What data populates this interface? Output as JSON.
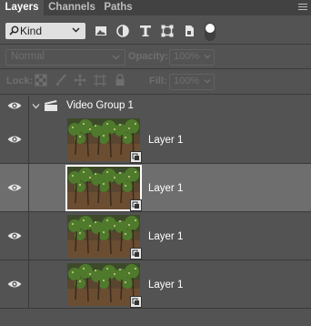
{
  "tabs": [
    {
      "label": "Layers",
      "active": true
    },
    {
      "label": "Channels",
      "active": false
    },
    {
      "label": "Paths",
      "active": false
    }
  ],
  "filter": {
    "kind_label": "Kind",
    "icons": [
      "image-filter-icon",
      "adjustment-filter-icon",
      "type-filter-icon",
      "shape-filter-icon",
      "smart-object-filter-icon",
      "filter-toggle-icon"
    ]
  },
  "blend": {
    "mode": "Normal",
    "opacity_label": "Opacity:",
    "opacity_value": "100%",
    "fill_label": "Fill:",
    "fill_value": "100%",
    "lock_label": "Lock:"
  },
  "group": {
    "name": "Video Group 1",
    "expanded": true
  },
  "layers": [
    {
      "name": "Layer 1",
      "selected": false
    },
    {
      "name": "Layer 1",
      "selected": true
    },
    {
      "name": "Layer 1",
      "selected": false
    },
    {
      "name": "Layer 1",
      "selected": false
    }
  ],
  "colors": {
    "panel": "#535353",
    "tabbar": "#424242",
    "selected_row": "#6e6e6e",
    "text": "#ffffff"
  }
}
